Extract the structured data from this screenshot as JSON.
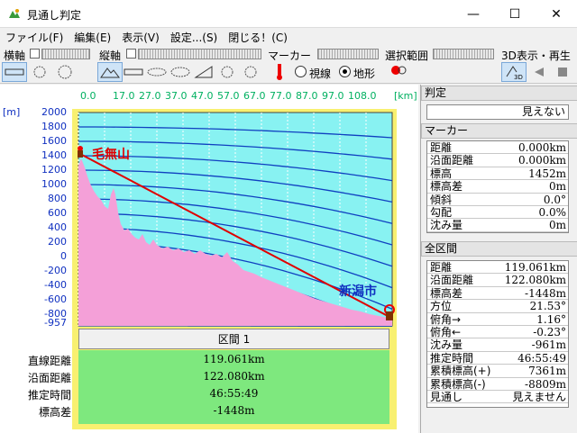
{
  "window": {
    "title": "見通し判定",
    "minimize": "—",
    "maximize": "☐",
    "close": "✕"
  },
  "menu": [
    "ファイル(F)",
    "編集(E)",
    "表示(V)",
    "設定...(S)",
    "閉じる！(C)"
  ],
  "toolbar": {
    "yokojiku": "横軸",
    "tatejiku": "縦軸",
    "marker": "マーカー",
    "selection": "選択範囲",
    "view3d": "3D表示・再生",
    "radio_sight": "視線",
    "radio_terrain": "地形",
    "selected_radio": "地形"
  },
  "chart": {
    "km_ticks": [
      "0.0",
      "17.0",
      "27.0",
      "37.0",
      "47.0",
      "57.0",
      "67.0",
      "77.0",
      "87.0",
      "97.0",
      "108.0"
    ],
    "km_unit": "[km]",
    "m_unit": "[m]",
    "m_ticks": [
      "2000",
      "1800",
      "1600",
      "1400",
      "1200",
      "1000",
      "800",
      "600",
      "400",
      "200",
      "0",
      "-200",
      "-400",
      "-600",
      "-800",
      "-957"
    ],
    "start_label": "毛無山",
    "end_label": "新潟市",
    "colors": {
      "sky": "#88f2f2",
      "terrain": "#f4a0d8",
      "sightline": "#e00000",
      "curvature": "#1040c0",
      "frame": "#f8f070"
    }
  },
  "section": {
    "title": "区間 1",
    "rows": [
      {
        "label": "直線距離",
        "value": "119.061km"
      },
      {
        "label": "沿面距離",
        "value": "122.080km"
      },
      {
        "label": "推定時間",
        "value": "46:55:49"
      },
      {
        "label": "標高差",
        "value": "-1448m"
      }
    ]
  },
  "side": {
    "judge_header": "判定",
    "judge_value": "見えない",
    "marker_header": "マーカー",
    "marker_rows": [
      {
        "k": "距離",
        "v": "0.000km"
      },
      {
        "k": "沿面距離",
        "v": "0.000km"
      },
      {
        "k": "標高",
        "v": "1452m"
      },
      {
        "k": "標高差",
        "v": "0m"
      },
      {
        "k": "傾斜",
        "v": "0.0°"
      },
      {
        "k": "勾配",
        "v": "0.0%"
      },
      {
        "k": "沈み量",
        "v": "0m"
      }
    ],
    "all_header": "全区間",
    "all_rows": [
      {
        "k": "距離",
        "v": "119.061km"
      },
      {
        "k": "沿面距離",
        "v": "122.080km"
      },
      {
        "k": "標高差",
        "v": "-1448m"
      },
      {
        "k": "方位",
        "v": "21.53°"
      },
      {
        "k": "俯角→",
        "v": "1.16°"
      },
      {
        "k": "俯角←",
        "v": "-0.23°"
      },
      {
        "k": "沈み量",
        "v": "-961m"
      },
      {
        "k": "推定時間",
        "v": "46:55:49"
      },
      {
        "k": "累積標高(+)",
        "v": "7361m"
      },
      {
        "k": "累積標高(-)",
        "v": "-8809m"
      },
      {
        "k": "見通し",
        "v": "見えません"
      }
    ]
  }
}
